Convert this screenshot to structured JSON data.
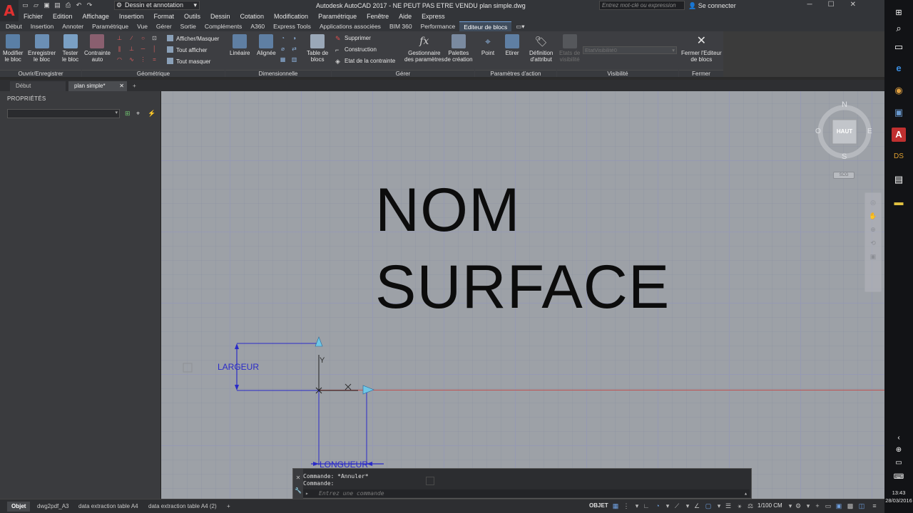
{
  "app": {
    "title": "Autodesk AutoCAD 2017 - NE PEUT PAS ETRE VENDU    plan simple.dwg",
    "logo_letter": "A",
    "workspace": "Dessin et annotation",
    "search_placeholder": "Entrez mot-clé ou expression",
    "login": "Se connecter"
  },
  "menu": [
    "Fichier",
    "Edition",
    "Affichage",
    "Insertion",
    "Format",
    "Outils",
    "Dessin",
    "Cotation",
    "Modification",
    "Paramétrique",
    "Fenêtre",
    "Aide",
    "Express"
  ],
  "ribbon_tabs": [
    "Début",
    "Insertion",
    "Annoter",
    "Paramétrique",
    "Vue",
    "Gérer",
    "Sortie",
    "Compléments",
    "A360",
    "Express Tools",
    "Applications associées",
    "BIM 360",
    "Performance",
    "Editeur de blocs"
  ],
  "ribbon_active_tab": "Editeur de blocs",
  "ribbon": {
    "modifier_bloc": [
      "Modifier",
      "le bloc"
    ],
    "enregistrer_bloc": [
      "Enregistrer",
      "le bloc"
    ],
    "tester_bloc": [
      "Tester",
      "le bloc"
    ],
    "contrainte_auto": [
      "Contrainte",
      "auto"
    ],
    "afficher_masquer": "Afficher/Masquer",
    "tout_afficher": "Tout afficher",
    "tout_masquer": "Tout masquer",
    "lineaire": "Linéaire",
    "alignee": "Alignée",
    "table_blocs": [
      "Table de",
      "blocs"
    ],
    "supprimer": "Supprimer",
    "construction": "Construction",
    "etat_contrainte": "Etat de la contrainte",
    "gestionnaire": [
      "Gestionnaire",
      "des paramètres"
    ],
    "palettes": [
      "Palettes",
      "de création"
    ],
    "point": "Point",
    "etirer": "Etirer",
    "definition_attribut": [
      "Définition",
      "d'attribut"
    ],
    "etats_visibilite": [
      "Etats de",
      "visibilité"
    ],
    "etat_visibilite_value": "EtatVisibilité0",
    "fermer": [
      "Fermer l'Editeur",
      "de blocs"
    ],
    "panels": {
      "ouvrir": "Ouvrir/Enregistrer",
      "geometrique": "Géométrique",
      "dimensionnelle": "Dimensionnelle",
      "gerer": "Gérer",
      "parametres_action": "Paramètres d'action",
      "visibilite": "Visibilité",
      "fermer": "Fermer"
    }
  },
  "doc_tabs": [
    "Début",
    "plan simple*"
  ],
  "properties": {
    "title": "PROPRIÉTÉS"
  },
  "canvas": {
    "text_line1": "NOM",
    "text_line2": "SURFACE",
    "largeur_label": "LARGEUR",
    "longueur_label": "LONGUEUR",
    "y_axis_label": "Y",
    "viewcube": {
      "n": "N",
      "s": "S",
      "e": "E",
      "o": "O",
      "face": "HAUT"
    },
    "wcs_label": "SCG"
  },
  "command": {
    "history": [
      "Commande: *Annuler*",
      "Commande:"
    ],
    "placeholder": "Entrez une commande"
  },
  "layout_tabs": [
    "Objet",
    "dwg2pdf_A3",
    "data extraction table A4",
    "data extraction table A4 (2)"
  ],
  "status": {
    "model": "OBJET",
    "scale": "1/100 CM"
  },
  "taskbar": {
    "time": "13:43",
    "date": "28/03/2016"
  },
  "colors": {
    "accent_red": "#e03030",
    "ribbon_active": "#3f4c5c",
    "dimension_blue": "#2a2ac8",
    "grip_cyan": "#6fc6e6"
  }
}
